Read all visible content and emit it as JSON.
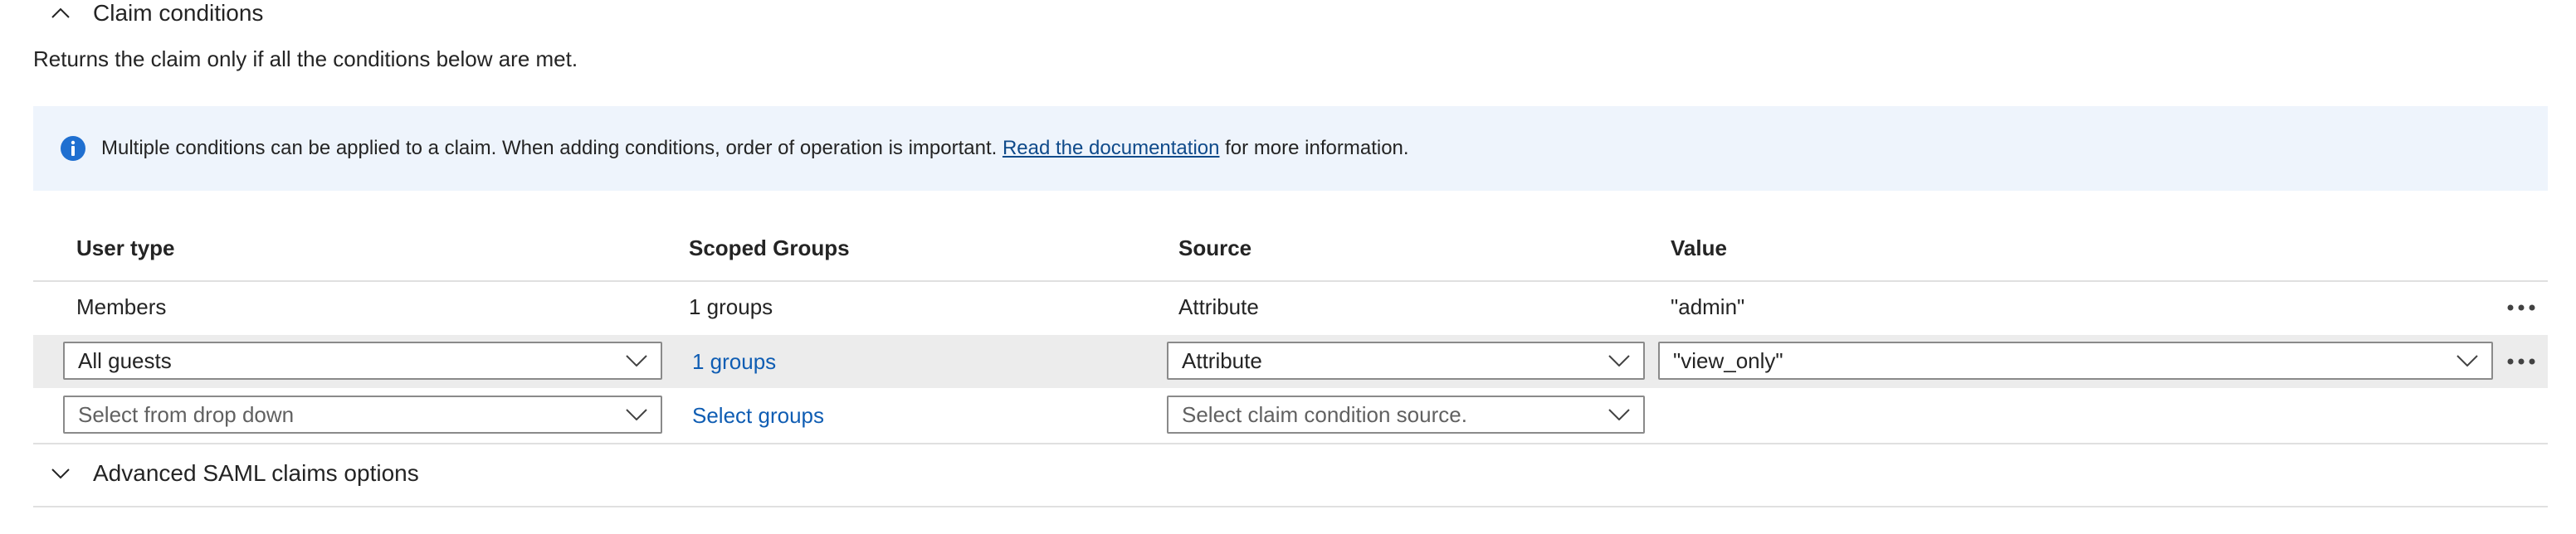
{
  "claim_conditions": {
    "title": "Claim conditions",
    "description": "Returns the claim only if all the conditions below are met.",
    "info": {
      "text_before": "Multiple conditions can be applied to a claim.  When adding conditions, order of operation is important. ",
      "link": "Read the documentation",
      "text_after": " for more information."
    },
    "columns": [
      "User type",
      "Scoped Groups",
      "Source",
      "Value"
    ],
    "rows": [
      {
        "user_type": "Members",
        "scoped_groups": "1 groups",
        "source": "Attribute",
        "value": "\"admin\""
      },
      {
        "user_type": "All guests",
        "scoped_groups": "1 groups",
        "source": "Attribute",
        "value": "\"view_only\""
      },
      {
        "user_type": "Select from drop down",
        "scoped_groups": "Select groups",
        "source": "Select claim condition source."
      }
    ]
  },
  "advanced": {
    "title": "Advanced SAML claims options"
  },
  "icons": {
    "collapse": "chevron-up-icon",
    "expand": "chevron-down-icon",
    "info": "info-icon",
    "more": "more-icon"
  },
  "colors": {
    "accent": "#0f5db3",
    "banner_bg": "#eef4fc",
    "info_icon": "#1f6fd0"
  }
}
